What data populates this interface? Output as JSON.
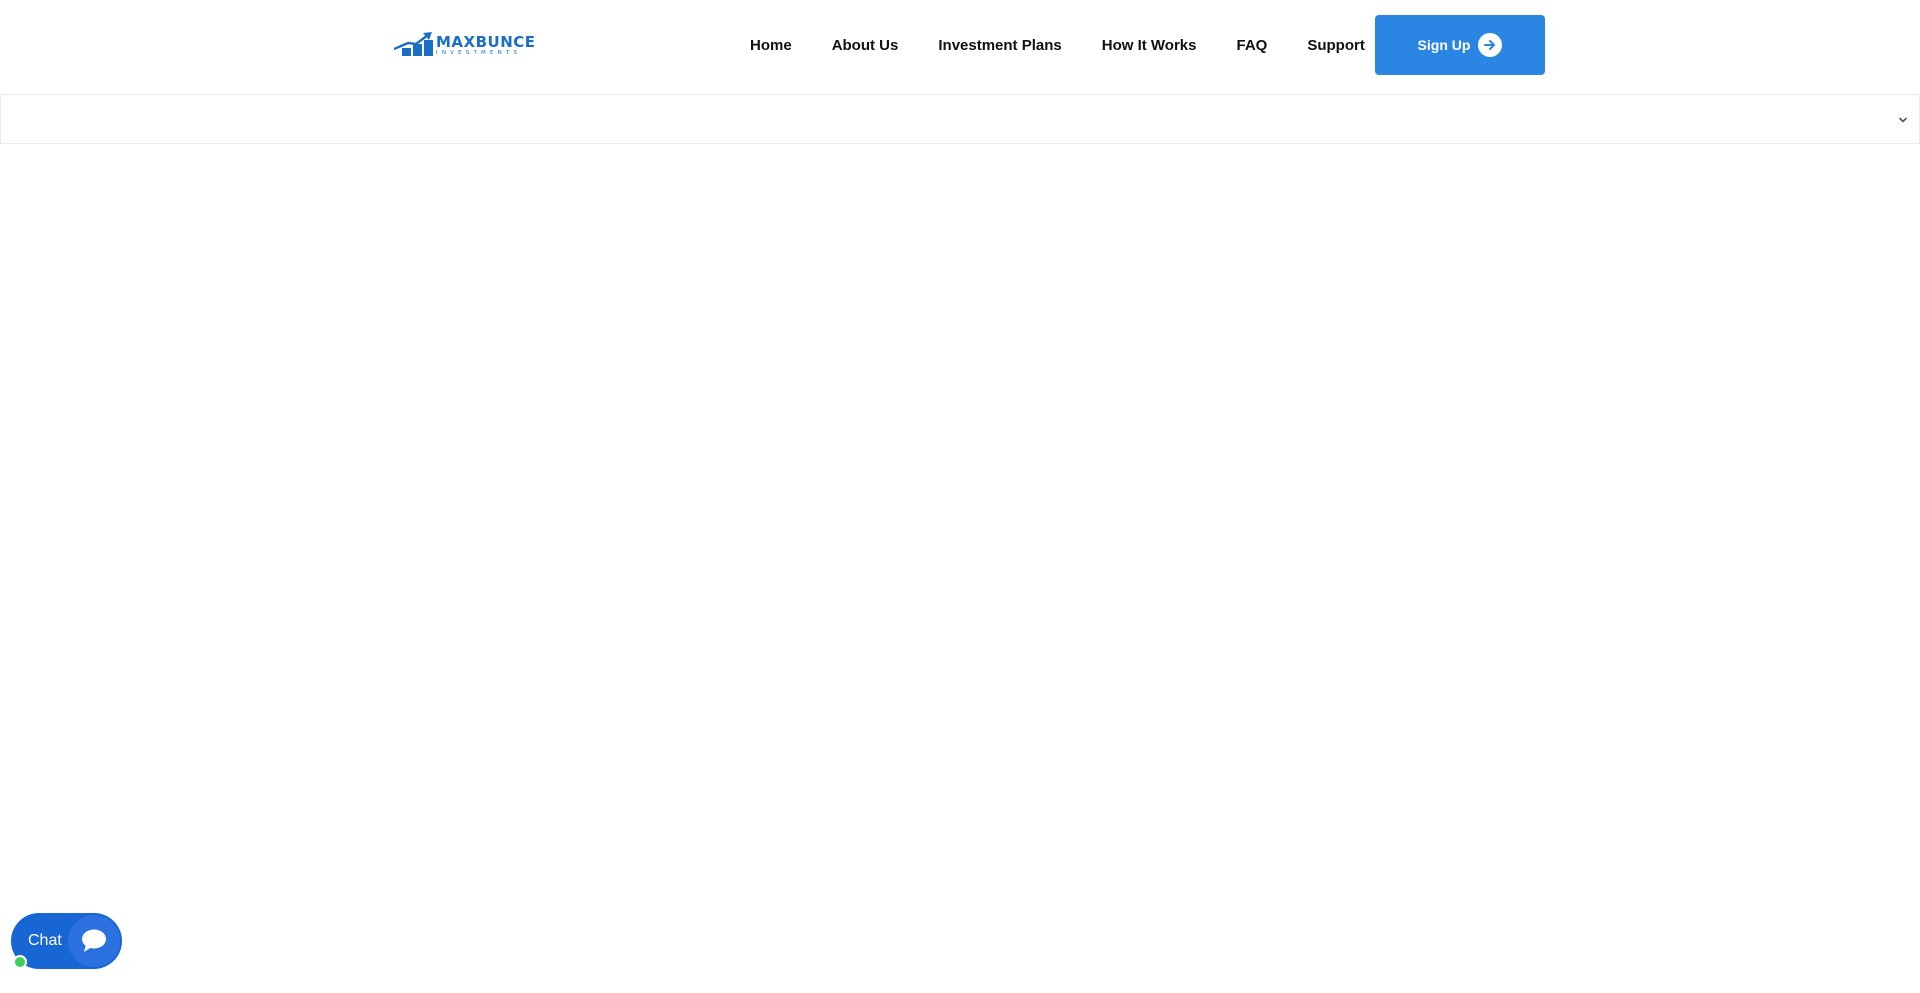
{
  "brand": {
    "name": "MAXBUNCE",
    "tagline": "INVESTMENTS",
    "color": "#1a6fc4"
  },
  "nav": {
    "items": [
      {
        "label": "Home"
      },
      {
        "label": "About Us"
      },
      {
        "label": "Investment Plans"
      },
      {
        "label": "How It Works"
      },
      {
        "label": "FAQ"
      },
      {
        "label": "Support"
      }
    ]
  },
  "signup": {
    "label": "Sign Up",
    "icon": "arrow-right-circle-icon",
    "color": "#2b86e3"
  },
  "ticker": {
    "icon": "chevron-down-icon"
  },
  "chat": {
    "label": "Chat",
    "icon": "chat-bubble-icon",
    "status_color": "#3fcf5c",
    "color": "#1866d4"
  }
}
